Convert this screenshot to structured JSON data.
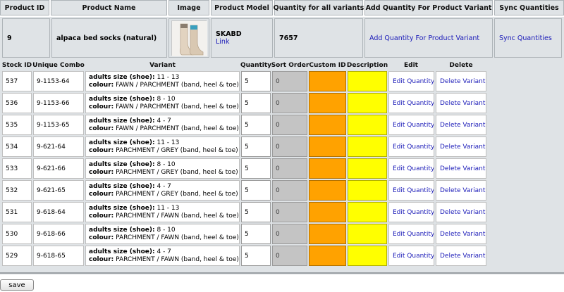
{
  "columns": {
    "product_id": "Product ID",
    "product_name": "Product Name",
    "image": "Image",
    "product_model": "Product Model",
    "quantity_all": "Quantity for all variants",
    "add_quantity": "Add Quantity For Product Variant",
    "sync": "Sync Quantities"
  },
  "product": {
    "id": "9",
    "name": "alpaca bed socks (natural)",
    "model": "SKABD",
    "link_label": "Link",
    "quantity": "7657",
    "add_quantity_link": "Add Quantity For Product Variant",
    "sync_link": "Sync Quantities"
  },
  "variant_columns": {
    "stock_id": "Stock ID",
    "unique_combo": "Unique Combo",
    "variant": "Variant",
    "quantity": "Quantity",
    "sort_order": "Sort Order",
    "custom_id": "Custom ID",
    "description": "Description",
    "edit": "Edit",
    "delete": "Delete"
  },
  "labels": {
    "size_label": "adults size (shoe):",
    "colour_label": "colour:",
    "edit_link": "Edit Quantity",
    "delete_link": "Delete Variant"
  },
  "variants": [
    {
      "stock_id": "537",
      "combo": "9-1153-64",
      "size": "11 - 13",
      "colour": "FAWN / PARCHMENT (band, heel & toe)",
      "quantity": "5",
      "sort_order": "0"
    },
    {
      "stock_id": "536",
      "combo": "9-1153-66",
      "size": "8 - 10",
      "colour": "FAWN / PARCHMENT (band, heel & toe)",
      "quantity": "5",
      "sort_order": "0"
    },
    {
      "stock_id": "535",
      "combo": "9-1153-65",
      "size": "4 - 7",
      "colour": "FAWN / PARCHMENT (band, heel & toe)",
      "quantity": "5",
      "sort_order": "0"
    },
    {
      "stock_id": "534",
      "combo": "9-621-64",
      "size": "11 - 13",
      "colour": "PARCHMENT / GREY (band, heel & toe)",
      "quantity": "5",
      "sort_order": "0"
    },
    {
      "stock_id": "533",
      "combo": "9-621-66",
      "size": "8 - 10",
      "colour": "PARCHMENT / GREY (band, heel & toe)",
      "quantity": "5",
      "sort_order": "0"
    },
    {
      "stock_id": "532",
      "combo": "9-621-65",
      "size": "4 - 7",
      "colour": "PARCHMENT / GREY (band, heel & toe)",
      "quantity": "5",
      "sort_order": "0"
    },
    {
      "stock_id": "531",
      "combo": "9-618-64",
      "size": "11 - 13",
      "colour": "PARCHMENT / FAWN (band, heel & toe)",
      "quantity": "5",
      "sort_order": "0"
    },
    {
      "stock_id": "530",
      "combo": "9-618-66",
      "size": "8 - 10",
      "colour": "PARCHMENT / FAWN (band, heel & toe)",
      "quantity": "5",
      "sort_order": "0"
    },
    {
      "stock_id": "529",
      "combo": "9-618-65",
      "size": "4 - 7",
      "colour": "PARCHMENT / FAWN (band, heel & toe)",
      "quantity": "5",
      "sort_order": "0"
    }
  ],
  "save_label": "save",
  "colors": {
    "header_bg": "#dfe3e6",
    "custom_id_bg": "#ffa200",
    "description_bg": "#ffff00",
    "sort_order_bg": "#c4c4c4",
    "link": "#1a1ab8"
  }
}
